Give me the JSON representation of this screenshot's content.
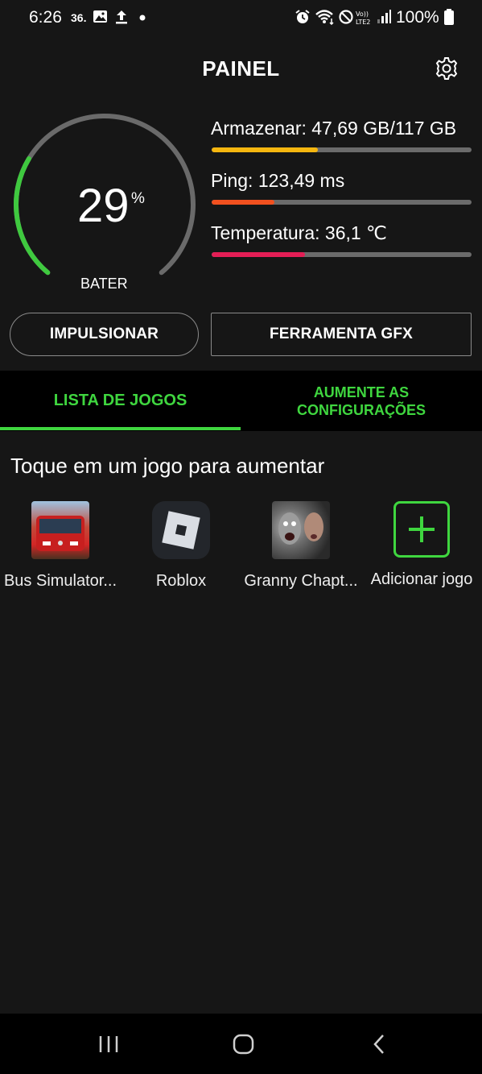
{
  "status_bar": {
    "time": "6:26",
    "notification_text": "36.",
    "battery": "100%"
  },
  "header": {
    "title": "PAINEL",
    "settings_icon": "gear-icon"
  },
  "battery_gauge": {
    "value": "29",
    "percent_sign": "%",
    "label": "BATER",
    "level": 0.29,
    "color": "#3fc93f"
  },
  "stats": [
    {
      "label": "Armazenar: 47,69 GB/117 GB",
      "fraction": 0.41,
      "color": "#f5b60f"
    },
    {
      "label": "Ping: 123,49 ms",
      "fraction": 0.24,
      "color": "#f1501f"
    },
    {
      "label": "Temperatura: 36,1 ℃",
      "fraction": 0.36,
      "color": "#e41e56"
    }
  ],
  "actions": {
    "boost_label": "IMPULSIONAR",
    "gfx_label": "FERRAMENTA GFX"
  },
  "tabs": {
    "game_list": "LISTA DE JOGOS",
    "boost_settings_line1": "AUMENTE AS",
    "boost_settings_line2": "CONFIGURAÇÕES"
  },
  "hint": "Toque em um jogo para aumentar",
  "games": [
    {
      "name": "Bus Simulator...",
      "icon": "bus-simulator-icon"
    },
    {
      "name": "Roblox",
      "icon": "roblox-icon"
    },
    {
      "name": "Granny Chapt...",
      "icon": "granny-icon"
    },
    {
      "name": "Adicionar jogo",
      "icon": "plus-icon"
    }
  ],
  "accent_color": "#3fd63f"
}
